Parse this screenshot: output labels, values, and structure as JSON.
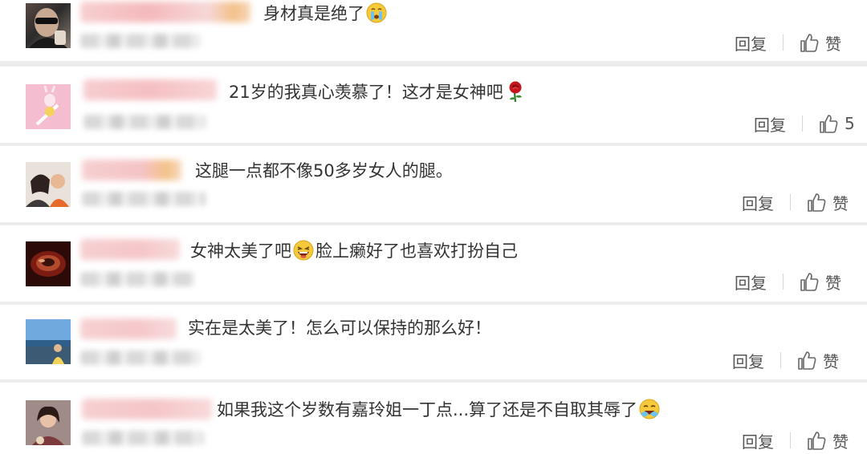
{
  "comments": [
    {
      "text_before": "身材真是绝了",
      "emoji_mid": "",
      "text_after": "",
      "emoji_end": "crying-face-emoji",
      "reply_label": "回复",
      "like_label": "赞"
    },
    {
      "text_before": "21岁的我真心羡慕了！这才是女神吧",
      "emoji_mid": "",
      "text_after": "",
      "emoji_end": "rose-emoji",
      "reply_label": "回复",
      "like_label": "5"
    },
    {
      "text_before": "这腿一点都不像50多岁女人的腿。",
      "emoji_mid": "",
      "text_after": "",
      "emoji_end": "",
      "reply_label": "回复",
      "like_label": "赞"
    },
    {
      "text_before": "女神太美了吧",
      "emoji_mid": "laughing-face-emoji",
      "text_after": "脸上癞好了也喜欢打扮自己",
      "emoji_end": "",
      "reply_label": "回复",
      "like_label": "赞"
    },
    {
      "text_before": "实在是太美了！怎么可以保持的那么好！",
      "emoji_mid": "",
      "text_after": "",
      "emoji_end": "",
      "reply_label": "回复",
      "like_label": "赞"
    },
    {
      "text_before": "如果我这个岁数有嘉玲姐一丁点...算了还是不自取其辱了",
      "emoji_mid": "",
      "text_after": "",
      "emoji_end": "sweat-laugh-emoji",
      "reply_label": "回复",
      "like_label": "赞"
    }
  ],
  "colors": {
    "text": "#333333",
    "action": "#555555",
    "separator": "#d6d6d6",
    "background": "#ececec",
    "card": "#ffffff"
  }
}
